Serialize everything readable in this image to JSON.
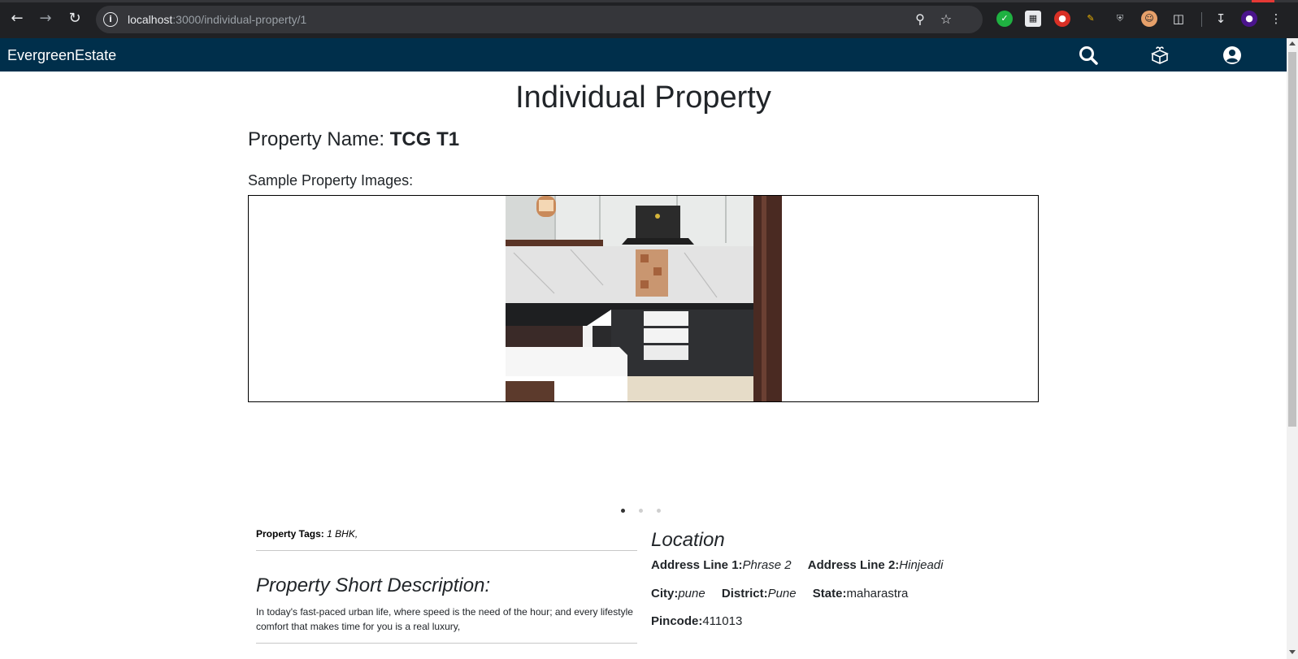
{
  "browser": {
    "url_host": "localhost",
    "url_path": ":3000/individual-property/1",
    "icons": [
      "back-arrow-icon",
      "forward-arrow-icon",
      "reload-icon",
      "site-info-icon",
      "zoom-icon",
      "bookmark-star-icon",
      "download-icon",
      "profile-avatar-icon",
      "menu-dots-icon"
    ]
  },
  "navbar": {
    "brand": "EvergreenEstate",
    "background": "#002f4b",
    "icons": [
      "search-icon",
      "gift-box-icon",
      "user-account-icon"
    ]
  },
  "page": {
    "title": "Individual Property",
    "property_name_label": "Property Name:",
    "property_name_value": "TCG T1",
    "images_label": "Sample Property Images:",
    "carousel": {
      "slide_count": 3,
      "active_index": 0,
      "current_image": "kitchen-photo"
    },
    "tags_label": "Property Tags:",
    "tags_value": "1 BHK,",
    "short_description_title": "Property Short Description:",
    "short_description": "In today's fast-paced urban life, where speed is the need of the hour; and every lifestyle comfort that makes time for you is a real luxury,",
    "location": {
      "title": "Location",
      "address_line_1_label": "Address Line 1:",
      "address_line_1": "Phrase 2",
      "address_line_2_label": "Address Line 2:",
      "address_line_2": "Hinjeadi",
      "city_label": "City:",
      "city": "pune",
      "district_label": "District:",
      "district": "Pune",
      "state_label": "State:",
      "state": "maharastra",
      "pincode_label": "Pincode:",
      "pincode": "411013"
    }
  }
}
